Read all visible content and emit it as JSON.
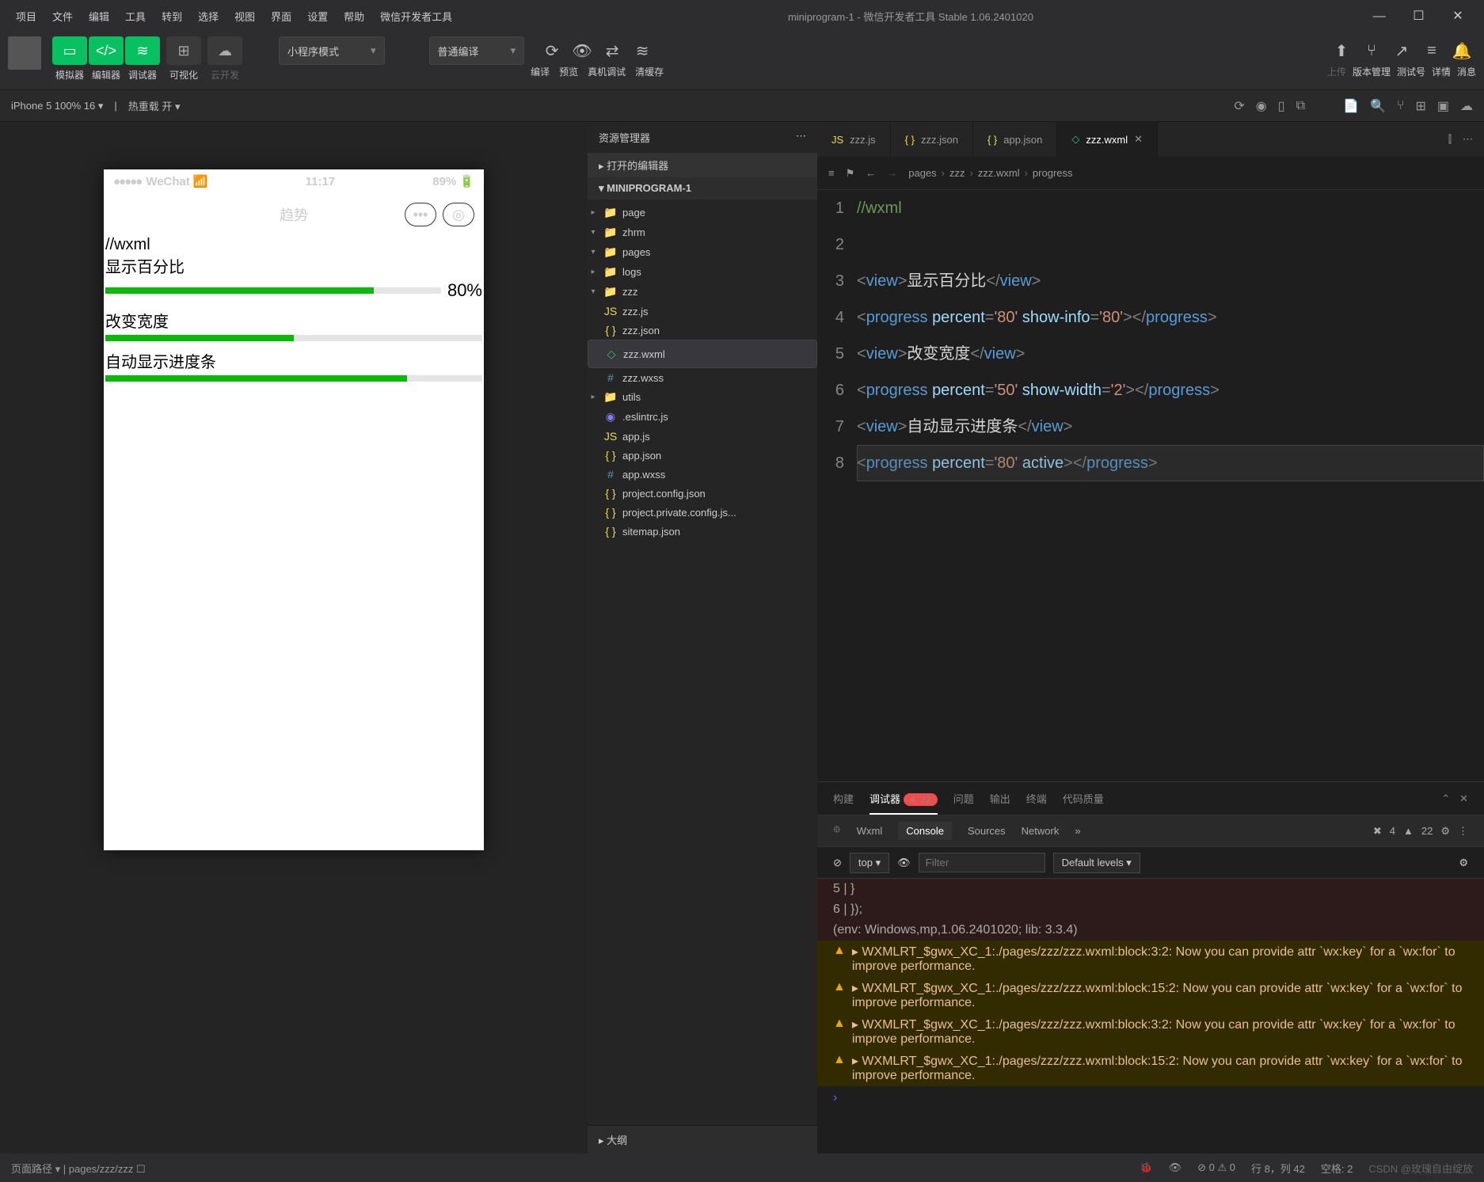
{
  "menu": [
    "项目",
    "文件",
    "编辑",
    "工具",
    "转到",
    "选择",
    "视图",
    "界面",
    "设置",
    "帮助",
    "微信开发者工具"
  ],
  "title": "miniprogram-1 - 微信开发者工具 Stable 1.06.2401020",
  "toolbar": {
    "btns": [
      {
        "labels": [
          "模拟器",
          "编辑器",
          "调试器"
        ]
      },
      {
        "label": "可视化"
      },
      {
        "label": "云开发",
        "dim": true
      }
    ],
    "mode": "小程序模式",
    "compile": "普通编译",
    "actions": [
      "编译",
      "预览",
      "真机调试",
      "清缓存"
    ],
    "right": [
      "上传",
      "版本管理",
      "测试号",
      "详情",
      "消息"
    ]
  },
  "secbar": {
    "device": "iPhone 5 100% 16",
    "hot": "热重载 开"
  },
  "phone": {
    "carrier": "WeChat",
    "time": "11:17",
    "battery": "89%",
    "title": "趋势",
    "l1": "//wxml",
    "l2": "显示百分比",
    "l3": "改变宽度",
    "l4": "自动显示进度条",
    "percent": "80%"
  },
  "explorer": {
    "title": "资源管理器",
    "openEditors": "打开的编辑器",
    "project": "MINIPROGRAM-1",
    "tree": [
      {
        "d": 1,
        "t": "folder",
        "n": "page",
        "chev": "▸"
      },
      {
        "d": 1,
        "t": "folder",
        "n": "zhrm",
        "chev": "▾"
      },
      {
        "d": 1,
        "t": "folder",
        "n": "pages",
        "chev": "▾"
      },
      {
        "d": 2,
        "t": "folder",
        "n": "logs",
        "chev": "▸"
      },
      {
        "d": 2,
        "t": "folder",
        "n": "zzz",
        "chev": "▾"
      },
      {
        "d": 3,
        "t": "js",
        "n": "zzz.js"
      },
      {
        "d": 3,
        "t": "json",
        "n": "zzz.json"
      },
      {
        "d": 3,
        "t": "wxml",
        "n": "zzz.wxml",
        "sel": true
      },
      {
        "d": 3,
        "t": "wxss",
        "n": "zzz.wxss"
      },
      {
        "d": 1,
        "t": "folder",
        "n": "utils",
        "chev": "▸"
      },
      {
        "d": 1,
        "t": "eslint",
        "n": ".eslintrc.js"
      },
      {
        "d": 1,
        "t": "js",
        "n": "app.js"
      },
      {
        "d": 1,
        "t": "json",
        "n": "app.json"
      },
      {
        "d": 1,
        "t": "wxss",
        "n": "app.wxss"
      },
      {
        "d": 1,
        "t": "json",
        "n": "project.config.json"
      },
      {
        "d": 1,
        "t": "json",
        "n": "project.private.config.js..."
      },
      {
        "d": 1,
        "t": "json",
        "n": "sitemap.json"
      }
    ],
    "outline": "大纲"
  },
  "tabs": [
    {
      "icon": "js",
      "label": "zzz.js"
    },
    {
      "icon": "json",
      "label": "zzz.json"
    },
    {
      "icon": "json",
      "label": "app.json"
    },
    {
      "icon": "wxml",
      "label": "zzz.wxml",
      "active": true,
      "close": true
    }
  ],
  "breadcrumb": [
    "pages",
    "zzz",
    "zzz.wxml",
    "progress"
  ],
  "code": {
    "lines": [
      {
        "n": 1,
        "raw": "//wxml",
        "cm": true
      },
      {
        "n": 2,
        "raw": ""
      },
      {
        "n": 3,
        "parts": [
          [
            "<",
            "p"
          ],
          [
            "view",
            "t"
          ],
          [
            ">",
            "p"
          ],
          [
            "显示百分比",
            "x"
          ],
          [
            "</",
            "p"
          ],
          [
            "view",
            "t"
          ],
          [
            ">",
            "p"
          ]
        ]
      },
      {
        "n": 4,
        "parts": [
          [
            "<",
            "p"
          ],
          [
            "progress",
            "t"
          ],
          [
            " ",
            "x"
          ],
          [
            "percent",
            "a"
          ],
          [
            "=",
            "p"
          ],
          [
            "'80'",
            "s"
          ],
          [
            " ",
            "x"
          ],
          [
            "show-info",
            "a"
          ],
          [
            "=",
            "p"
          ],
          [
            "'80'",
            "s"
          ],
          [
            "></",
            "p"
          ],
          [
            "progress",
            "t"
          ],
          [
            ">",
            "p"
          ]
        ]
      },
      {
        "n": 5,
        "parts": [
          [
            "<",
            "p"
          ],
          [
            "view",
            "t"
          ],
          [
            ">",
            "p"
          ],
          [
            "改变宽度",
            "x"
          ],
          [
            "</",
            "p"
          ],
          [
            "view",
            "t"
          ],
          [
            ">",
            "p"
          ]
        ]
      },
      {
        "n": 6,
        "parts": [
          [
            "<",
            "p"
          ],
          [
            "progress",
            "t"
          ],
          [
            " ",
            "x"
          ],
          [
            "percent",
            "a"
          ],
          [
            "=",
            "p"
          ],
          [
            "'50'",
            "s"
          ],
          [
            " ",
            "x"
          ],
          [
            "show-width",
            "a"
          ],
          [
            "=",
            "p"
          ],
          [
            "'2'",
            "s"
          ],
          [
            "></",
            "p"
          ],
          [
            "progress",
            "t"
          ],
          [
            ">",
            "p"
          ]
        ]
      },
      {
        "n": 7,
        "parts": [
          [
            "<",
            "p"
          ],
          [
            "view",
            "t"
          ],
          [
            ">",
            "p"
          ],
          [
            "自动显示进度条",
            "x"
          ],
          [
            "</",
            "p"
          ],
          [
            "view",
            "t"
          ],
          [
            ">",
            "p"
          ]
        ]
      },
      {
        "n": 8,
        "parts": [
          [
            "<",
            "p"
          ],
          [
            "progress",
            "t"
          ],
          [
            " ",
            "x"
          ],
          [
            "percent",
            "a"
          ],
          [
            "=",
            "p"
          ],
          [
            "'80'",
            "s"
          ],
          [
            " ",
            "x"
          ],
          [
            "active",
            "a"
          ],
          [
            "></",
            "p"
          ],
          [
            "progress",
            "t"
          ],
          [
            ">",
            "p"
          ]
        ]
      }
    ]
  },
  "panel": {
    "tabs": [
      "构建",
      "调试器",
      "问题",
      "输出",
      "终端",
      "代码质量"
    ],
    "active": 1,
    "badge": "4, 22",
    "devtabs": [
      "Wxml",
      "Console",
      "Sources",
      "Network"
    ],
    "devactive": 1,
    "errors": "4",
    "warnings": "22",
    "ctx": "top",
    "filter": "Filter",
    "levels": "Default levels",
    "out": [
      {
        "c": "dark",
        "t": "  5 | }"
      },
      {
        "c": "dark",
        "t": "  6 | });"
      },
      {
        "c": "dark",
        "t": "(env: Windows,mp,1.06.2401020; lib: 3.3.4)"
      },
      {
        "c": "warn",
        "t": "▸ WXMLRT_$gwx_XC_1:./pages/zzz/zzz.wxml:block:3:2: Now you can provide attr `wx:key` for a `wx:for` to improve performance."
      },
      {
        "c": "warn",
        "t": "▸ WXMLRT_$gwx_XC_1:./pages/zzz/zzz.wxml:block:15:2: Now you can provide attr `wx:key` for a `wx:for` to improve performance."
      },
      {
        "c": "warn",
        "t": "▸ WXMLRT_$gwx_XC_1:./pages/zzz/zzz.wxml:block:3:2: Now you can provide attr `wx:key` for a `wx:for` to improve performance."
      },
      {
        "c": "warn",
        "t": "▸ WXMLRT_$gwx_XC_1:./pages/zzz/zzz.wxml:block:15:2: Now you can provide attr `wx:key` for a `wx:for` to improve performance."
      }
    ],
    "prompt": "›"
  },
  "status": {
    "path_lbl": "页面路径",
    "path": "pages/zzz/zzz",
    "stat1": "⊘ 0 ⚠ 0",
    "pos": "行 8，列 42",
    "spaces": "空格: 2",
    "watermark": "CSDN @玫瑰自由绽放"
  }
}
